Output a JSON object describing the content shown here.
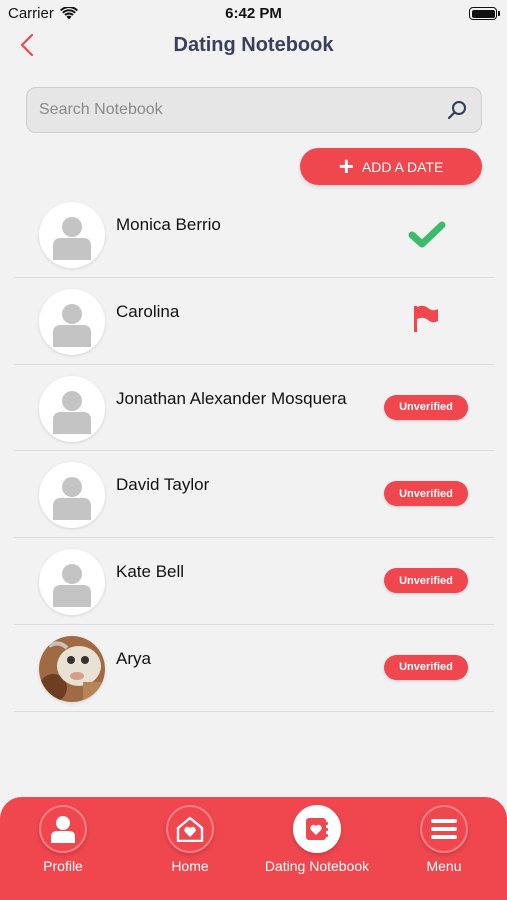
{
  "status_bar": {
    "carrier": "Carrier",
    "time": "6:42 PM"
  },
  "header": {
    "title": "Dating Notebook",
    "back_icon": "chevron-left-icon"
  },
  "search": {
    "placeholder": "Search Notebook",
    "value": ""
  },
  "add_button": {
    "label": "ADD A DATE",
    "icon": "plus-icon"
  },
  "contacts": [
    {
      "name": "Monica Berrio",
      "status": "checkmark",
      "avatar": "default"
    },
    {
      "name": "Carolina",
      "status": "flag",
      "avatar": "default"
    },
    {
      "name": "Jonathan Alexander Mosquera",
      "status": "badge",
      "badge": "Unverified",
      "avatar": "default"
    },
    {
      "name": "David Taylor",
      "status": "badge",
      "badge": "Unverified",
      "avatar": "default"
    },
    {
      "name": "Kate Bell",
      "status": "badge",
      "badge": "Unverified",
      "avatar": "default"
    },
    {
      "name": "Arya",
      "status": "badge",
      "badge": "Unverified",
      "avatar": "photo"
    }
  ],
  "tabs": [
    {
      "label": "Profile",
      "icon": "person-icon",
      "active": false
    },
    {
      "label": "Home",
      "icon": "home-heart-icon",
      "active": false
    },
    {
      "label": "Dating Notebook",
      "icon": "notebook-heart-icon",
      "active": true
    },
    {
      "label": "Menu",
      "icon": "menu-icon",
      "active": false
    }
  ],
  "colors": {
    "accent": "#f0474f",
    "check": "#3dbb6a",
    "title": "#3a3f5c"
  }
}
